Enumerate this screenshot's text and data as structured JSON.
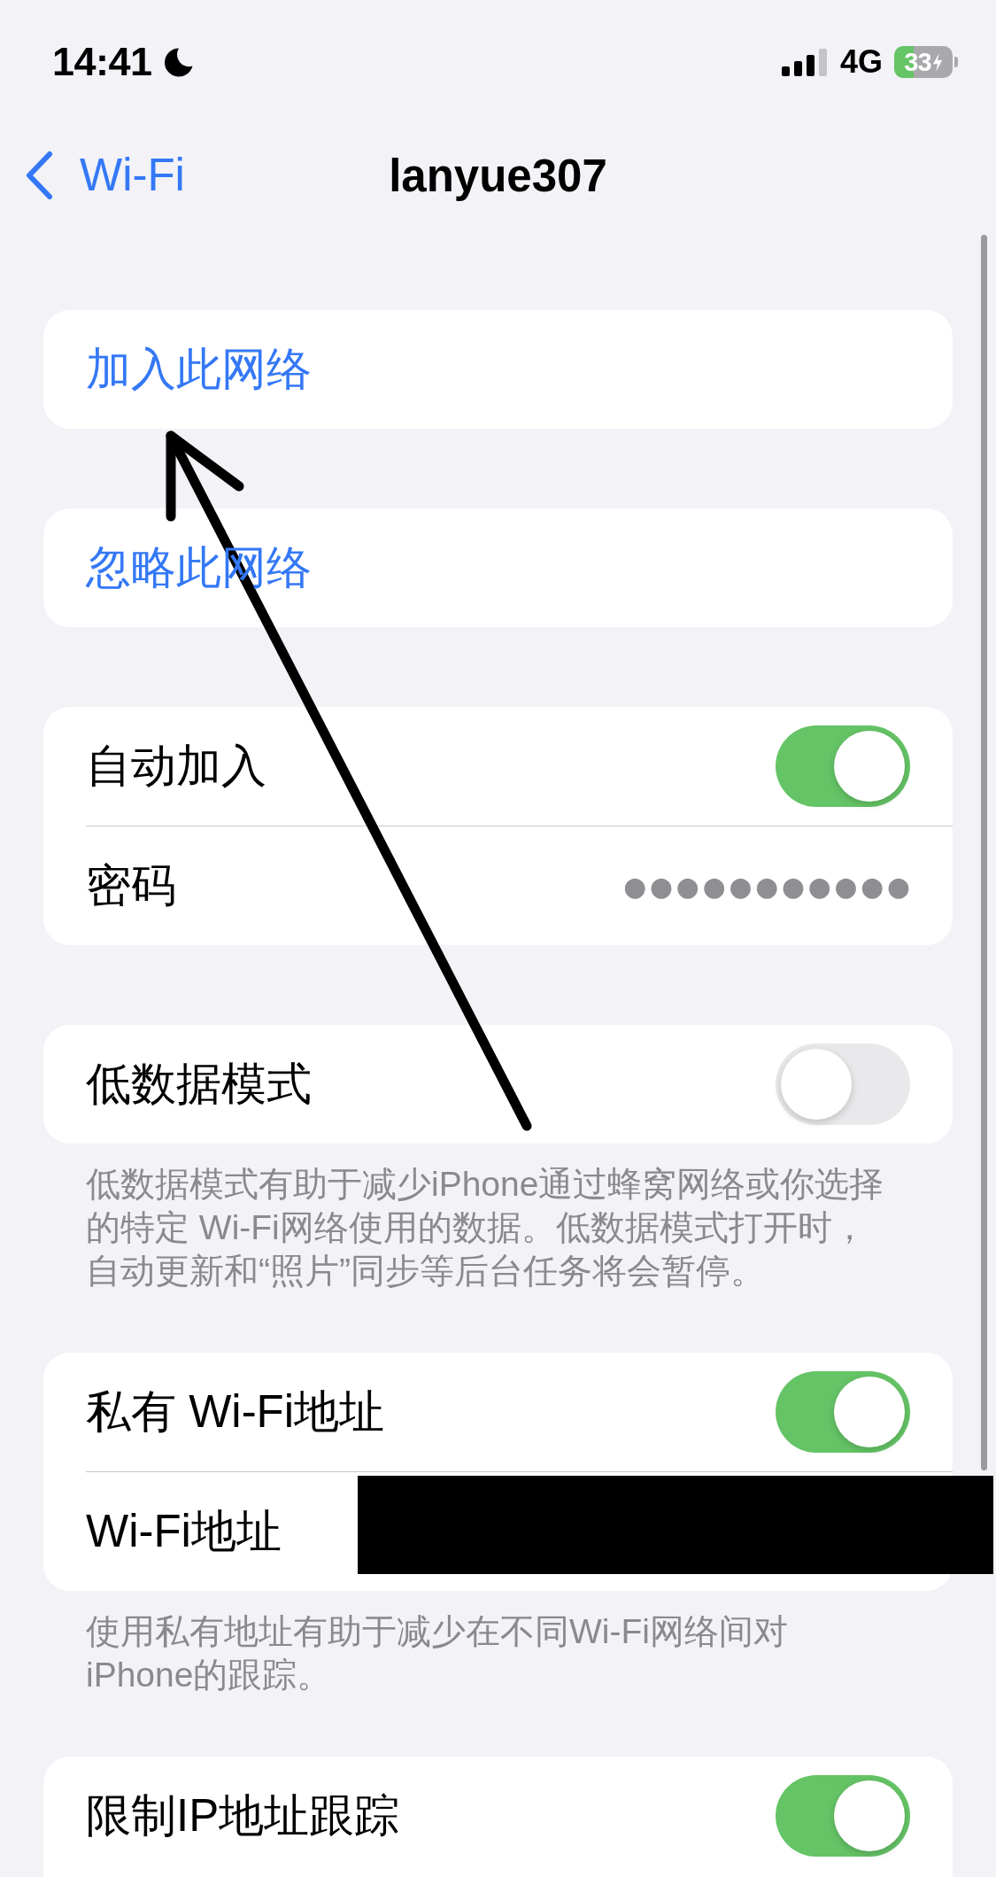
{
  "status_bar": {
    "time": "14:41",
    "network": "4G",
    "battery": "33"
  },
  "nav_bar": {
    "back_label": "Wi-Fi",
    "title": "lanyue307"
  },
  "groups": [
    {
      "rows": [
        {
          "kind": "action",
          "label": "加入此网络"
        }
      ]
    },
    {
      "rows": [
        {
          "kind": "action",
          "label": "忽略此网络"
        }
      ]
    },
    {
      "rows": [
        {
          "kind": "toggle",
          "label": "自动加入",
          "on": true
        },
        {
          "kind": "value",
          "label": "密码",
          "value": "●●●●●●●●●●●",
          "redacted": false
        }
      ]
    },
    {
      "rows": [
        {
          "kind": "toggle",
          "label": "低数据模式",
          "on": false
        }
      ],
      "footer": "低数据模式有助于减少iPhone通过蜂窝网络或你选择的特定 Wi-Fi网络使用的数据。低数据模式打开时，自动更新和“照片”同步等后台任务将会暂停。"
    },
    {
      "rows": [
        {
          "kind": "toggle",
          "label": "私有 Wi-Fi地址",
          "on": true
        },
        {
          "kind": "value",
          "label": "Wi-Fi地址",
          "redacted": true
        }
      ],
      "footer": "使用私有地址有助于减少在不同Wi-Fi网络间对iPhone的跟踪。"
    },
    {
      "rows": [
        {
          "kind": "toggle",
          "label": "限制IP地址跟踪",
          "on": true
        }
      ]
    }
  ],
  "annotation": {
    "kind": "arrow"
  }
}
